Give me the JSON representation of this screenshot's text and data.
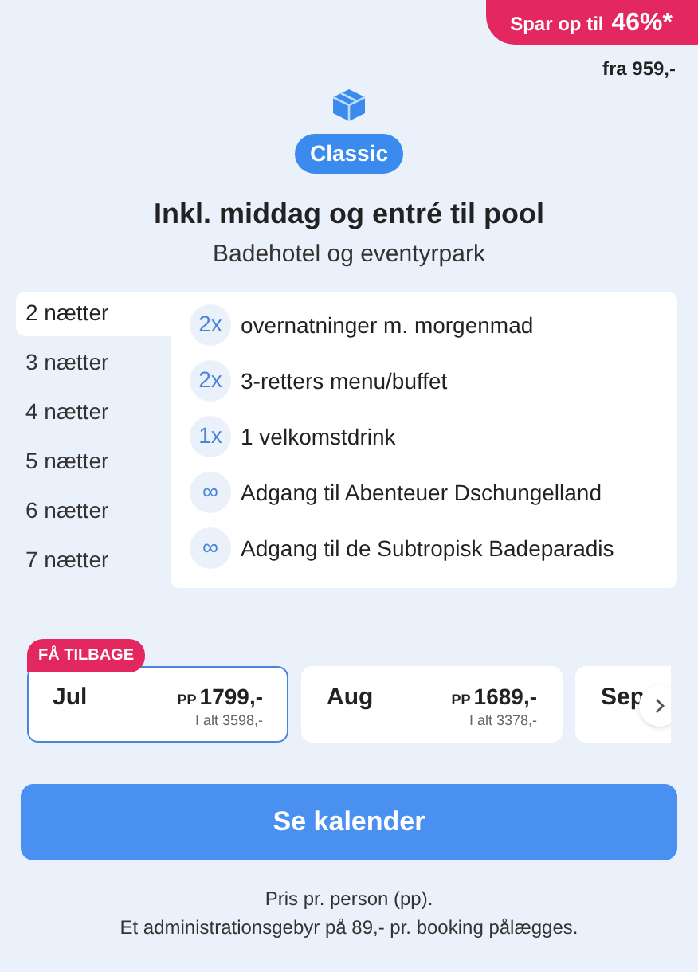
{
  "promo": {
    "label": "Spar op til",
    "value": "46%*",
    "from_price": "fra 959,-"
  },
  "package": {
    "tag": "Classic",
    "title": "Inkl. middag og entré til pool",
    "subtitle": "Badehotel og eventyrpark"
  },
  "nights": [
    {
      "label": "2 nætter",
      "selected": true
    },
    {
      "label": "3 nætter",
      "selected": false
    },
    {
      "label": "4 nætter",
      "selected": false
    },
    {
      "label": "5 nætter",
      "selected": false
    },
    {
      "label": "6 nætter",
      "selected": false
    },
    {
      "label": "7 nætter",
      "selected": false
    }
  ],
  "features": [
    {
      "count": "2x",
      "text": "overnatninger m. morgenmad"
    },
    {
      "count": "2x",
      "text": "3-retters menu/buffet"
    },
    {
      "count": "1x",
      "text": "1 velkomstdrink"
    },
    {
      "count": "∞",
      "text": "Adgang til Abenteuer Dschungelland"
    },
    {
      "count": "∞",
      "text": "Adgang til de Subtropisk Badeparadis"
    }
  ],
  "months": [
    {
      "badge": "FÅ TILBAGE",
      "month": "Jul",
      "pp": "PP",
      "price": "1799,-",
      "total": "I alt 3598,-",
      "selected": true
    },
    {
      "month": "Aug",
      "pp": "PP",
      "price": "1689,-",
      "total": "I alt 3378,-",
      "selected": false
    },
    {
      "month": "Sep",
      "selected": false
    }
  ],
  "calendar_button": "Se kalender",
  "footnotes": [
    "Pris pr. person (pp).",
    "Et administrationsgebyr på 89,- pr. booking pålægges."
  ]
}
